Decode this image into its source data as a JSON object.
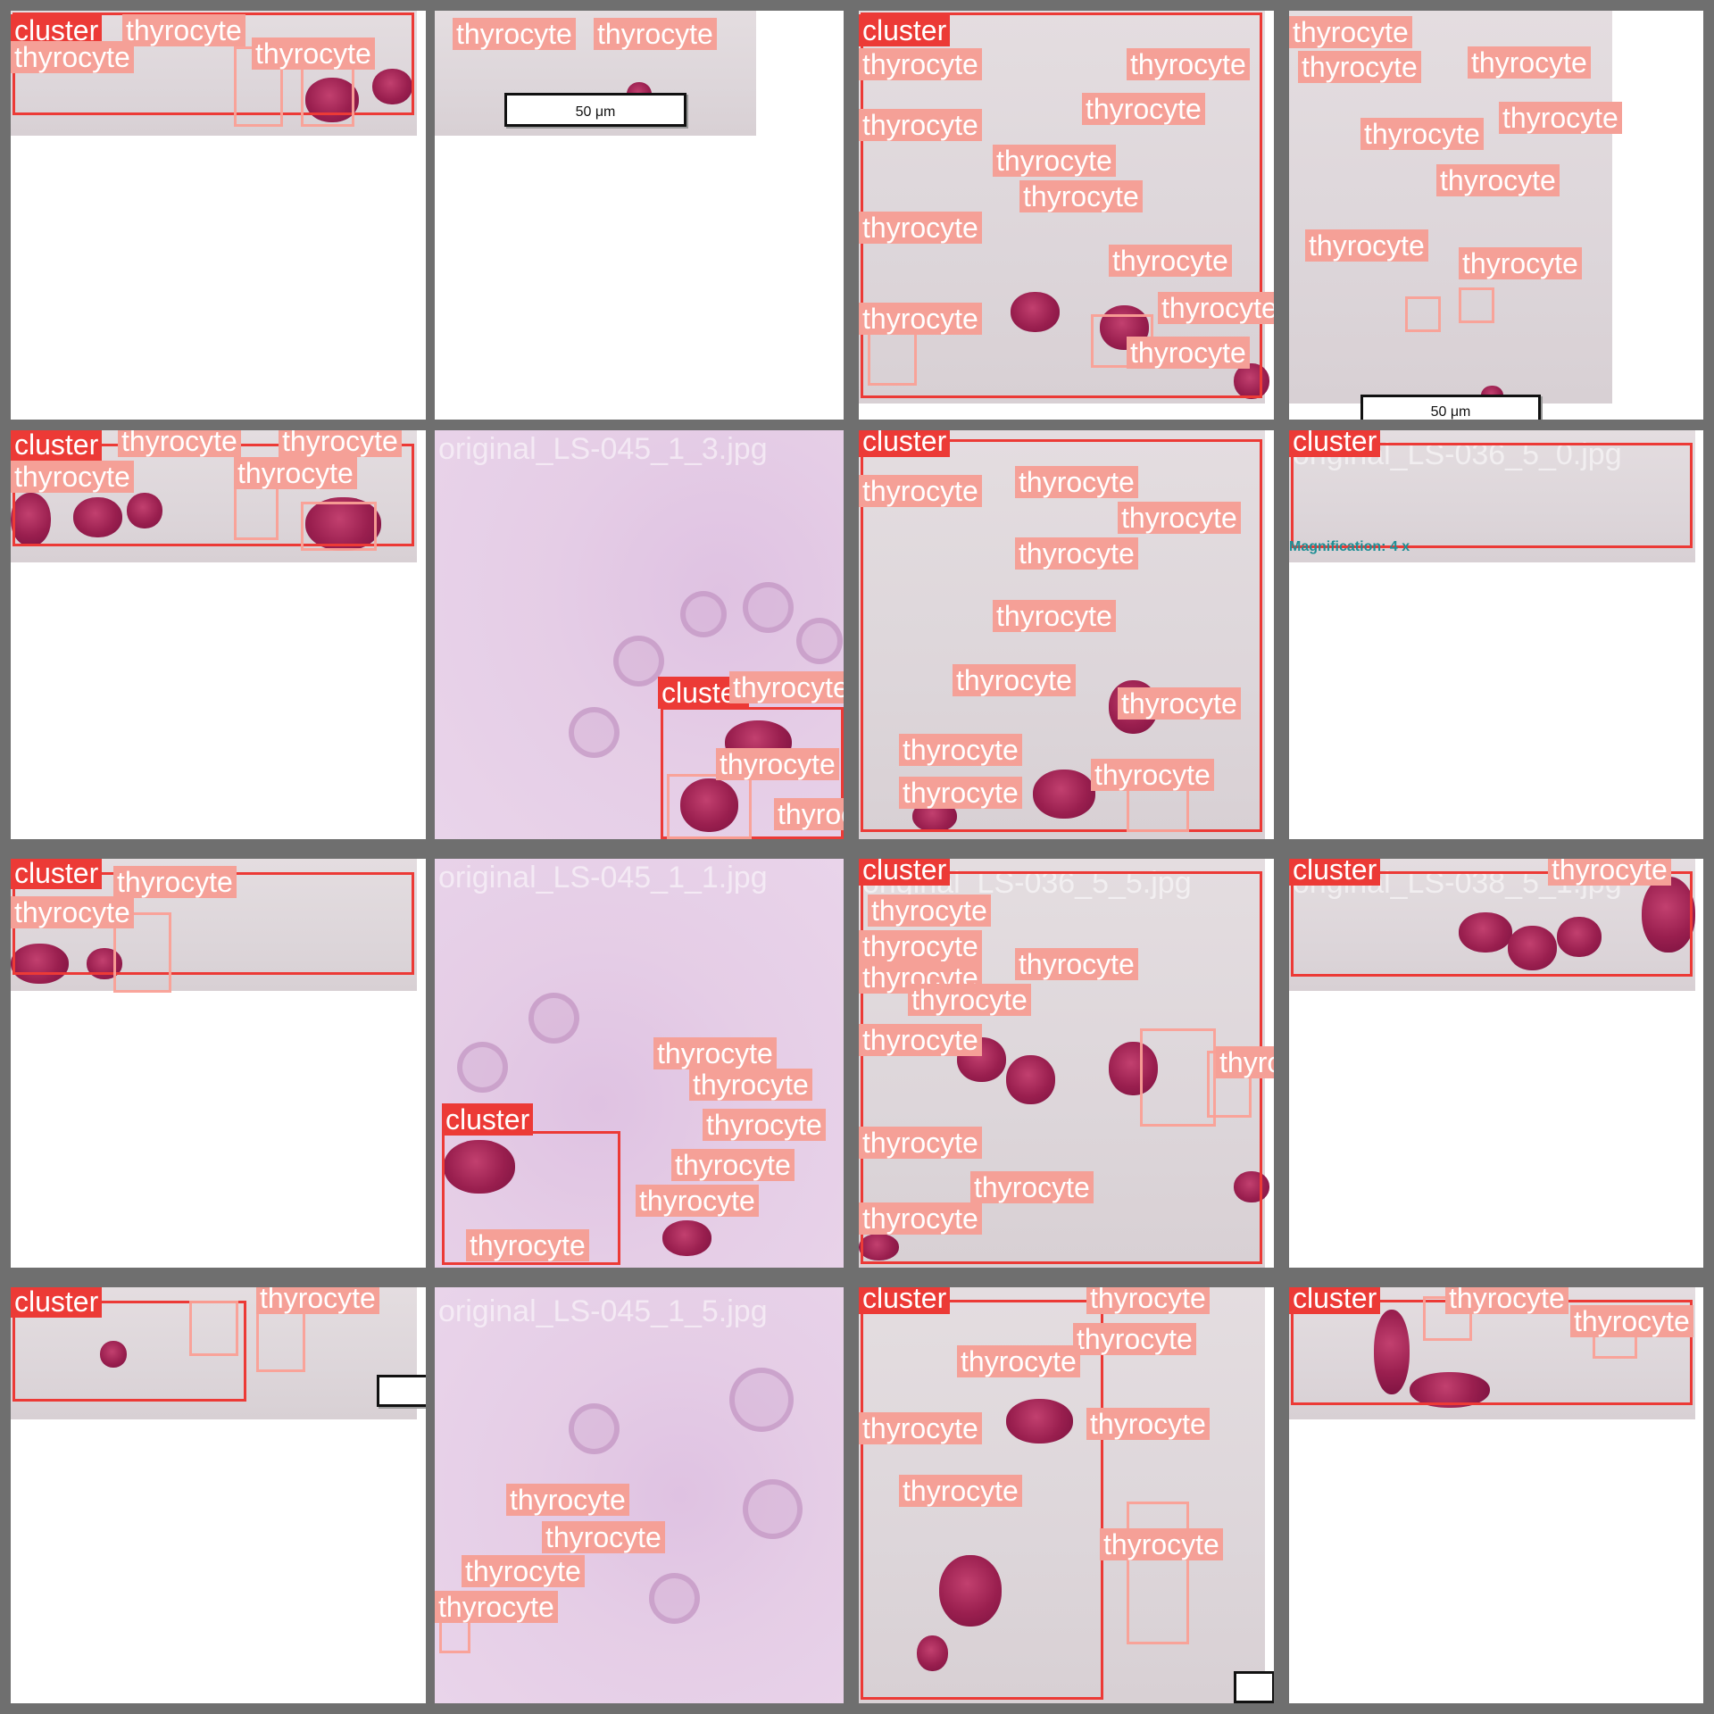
{
  "labels": {
    "cluster": "cluster",
    "thyrocyte": "thyrocyte"
  },
  "filenames": {
    "t6": "original_LS-045_1_3.jpg",
    "t8": "original_LS-036_5_0.jpg",
    "t10": "original_LS-045_1_1.jpg",
    "t11": "original_LS-036_5_5.jpg",
    "t12": "original_LS-038_5_1.jpg",
    "t14": "original_LS-045_1_5.jpg"
  },
  "scalebars": {
    "t2": "50 μm",
    "t4": "50 μm"
  },
  "magnification": "Magnification: 4 x",
  "colors": {
    "cluster_box": "#ec3a36",
    "thyrocyte_box": "#f5a097",
    "tile_border": "#6f6f6f"
  }
}
